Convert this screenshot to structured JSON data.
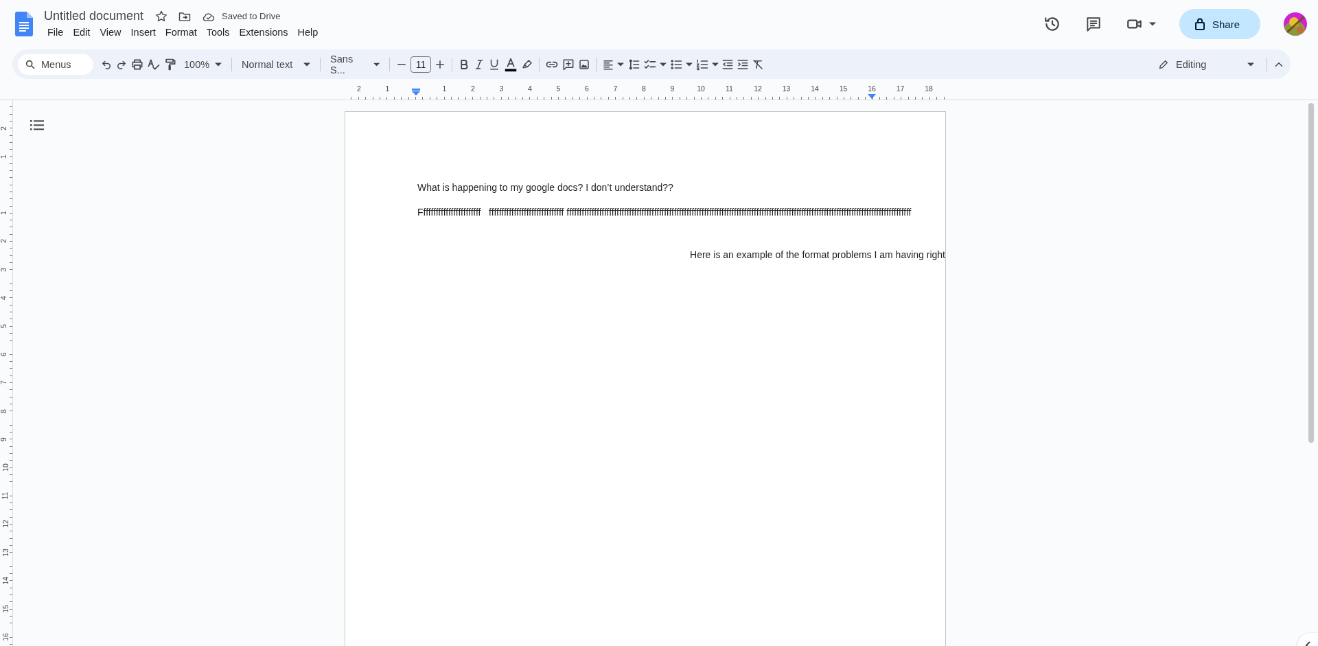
{
  "app": {
    "title": "Untitled document",
    "save_status": "Saved to Drive"
  },
  "menu": [
    "File",
    "Edit",
    "View",
    "Insert",
    "Format",
    "Tools",
    "Extensions",
    "Help"
  ],
  "share": {
    "label": "Share"
  },
  "toolbar": {
    "search_placeholder": "Menus",
    "zoom": "100%",
    "style": "Normal text",
    "font": "Sans S...",
    "font_size": "11",
    "mode": "Editing"
  },
  "ruler": {
    "labels": [
      "2",
      "1",
      "1",
      "2",
      "3",
      "4",
      "5",
      "6",
      "7",
      "8",
      "9",
      "10",
      "11",
      "12",
      "13",
      "14",
      "15",
      "16",
      "17",
      "18"
    ]
  },
  "vertical_ruler": {
    "labels": [
      "2",
      "1",
      "1",
      "2",
      "3",
      "4",
      "5",
      "6",
      "7",
      "8",
      "9",
      "10",
      "11",
      "12",
      "13",
      "14",
      "15",
      "16"
    ]
  },
  "document": {
    "paragraphs": [
      {
        "kind": "left",
        "text": "What is happening to my google docs? I don’t understand??"
      },
      {
        "kind": "left",
        "text": "Ffffffffffffffffffffffff   ffffffffffffffffffffffffffffff ffffffffffffffffffffffffffffffffffffffffffffffffffffffffffffffffffffffffffffffffffffffffffffffffffffffffffffffffffffffffffffffffffffffffff"
      },
      {
        "kind": "right",
        "text": "Here is an example of the format problems I am having right"
      }
    ]
  }
}
